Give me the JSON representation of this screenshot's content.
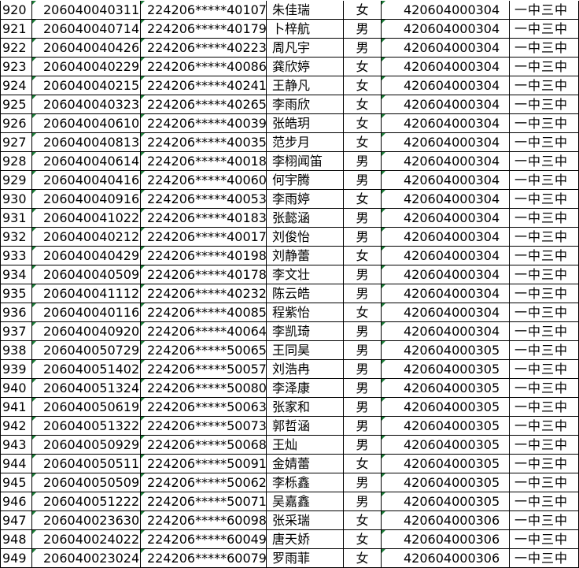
{
  "rows": [
    [
      "920",
      "206040040311",
      "224206*****40107",
      "朱佳瑞",
      "女",
      "420604000304",
      "一中三中"
    ],
    [
      "921",
      "206040040714",
      "224206*****40179",
      "卜梓航",
      "男",
      "420604000304",
      "一中三中"
    ],
    [
      "922",
      "206040040426",
      "224206*****40223",
      "周凡宇",
      "男",
      "420604000304",
      "一中三中"
    ],
    [
      "923",
      "206040040229",
      "224206*****40086",
      "龚欣婷",
      "女",
      "420604000304",
      "一中三中"
    ],
    [
      "924",
      "206040040215",
      "224206*****40241",
      "王静凡",
      "女",
      "420604000304",
      "一中三中"
    ],
    [
      "925",
      "206040040323",
      "224206*****40265",
      "李雨欣",
      "女",
      "420604000304",
      "一中三中"
    ],
    [
      "926",
      "206040040610",
      "224206*****40039",
      "张皓玥",
      "女",
      "420604000304",
      "一中三中"
    ],
    [
      "927",
      "206040040813",
      "224206*****40035",
      "范步月",
      "女",
      "420604000304",
      "一中三中"
    ],
    [
      "928",
      "206040040614",
      "224206*****40018",
      "李栩闻笛",
      "男",
      "420604000304",
      "一中三中"
    ],
    [
      "929",
      "206040040416",
      "224206*****40060",
      "何宇腾",
      "男",
      "420604000304",
      "一中三中"
    ],
    [
      "930",
      "206040040916",
      "224206*****40053",
      "李雨婷",
      "女",
      "420604000304",
      "一中三中"
    ],
    [
      "931",
      "206040041022",
      "224206*****40183",
      "张懿涵",
      "男",
      "420604000304",
      "一中三中"
    ],
    [
      "932",
      "206040040212",
      "224206*****40017",
      "刘俊怡",
      "男",
      "420604000304",
      "一中三中"
    ],
    [
      "933",
      "206040040429",
      "224206*****40198",
      "刘静蕾",
      "女",
      "420604000304",
      "一中三中"
    ],
    [
      "934",
      "206040040509",
      "224206*****40178",
      "李文壮",
      "男",
      "420604000304",
      "一中三中"
    ],
    [
      "935",
      "206040041112",
      "224206*****40232",
      "陈云皓",
      "男",
      "420604000304",
      "一中三中"
    ],
    [
      "936",
      "206040040116",
      "224206*****40085",
      "程紫怡",
      "女",
      "420604000304",
      "一中三中"
    ],
    [
      "937",
      "206040040920",
      "224206*****40064",
      "李凯琦",
      "男",
      "420604000304",
      "一中三中"
    ],
    [
      "938",
      "206040050729",
      "224206*****50065",
      "王同昊",
      "男",
      "420604000305",
      "一中三中"
    ],
    [
      "939",
      "206040051402",
      "224206*****50057",
      "刘浩冉",
      "男",
      "420604000305",
      "一中三中"
    ],
    [
      "940",
      "206040051324",
      "224206*****50080",
      "李泽康",
      "男",
      "420604000305",
      "一中三中"
    ],
    [
      "941",
      "206040050619",
      "224206*****50063",
      "张家和",
      "男",
      "420604000305",
      "一中三中"
    ],
    [
      "942",
      "206040051322",
      "224206*****50073",
      "郭哲涵",
      "男",
      "420604000305",
      "一中三中"
    ],
    [
      "943",
      "206040050929",
      "224206*****50068",
      "王灿",
      "男",
      "420604000305",
      "一中三中"
    ],
    [
      "944",
      "206040050511",
      "224206*****50091",
      "金婧蕾",
      "女",
      "420604000305",
      "一中三中"
    ],
    [
      "945",
      "206040050509",
      "224206*****50062",
      "李栎鑫",
      "男",
      "420604000305",
      "一中三中"
    ],
    [
      "946",
      "206040051222",
      "224206*****50071",
      "吴嘉鑫",
      "男",
      "420604000305",
      "一中三中"
    ],
    [
      "947",
      "206040023630",
      "224206*****60098",
      "张采瑞",
      "女",
      "420604000306",
      "一中三中"
    ],
    [
      "948",
      "206040024022",
      "224206*****60049",
      "唐天娇",
      "女",
      "420604000306",
      "一中三中"
    ],
    [
      "949",
      "206040023024",
      "224206*****60079",
      "罗雨菲",
      "女",
      "420604000306",
      "一中三中"
    ]
  ]
}
